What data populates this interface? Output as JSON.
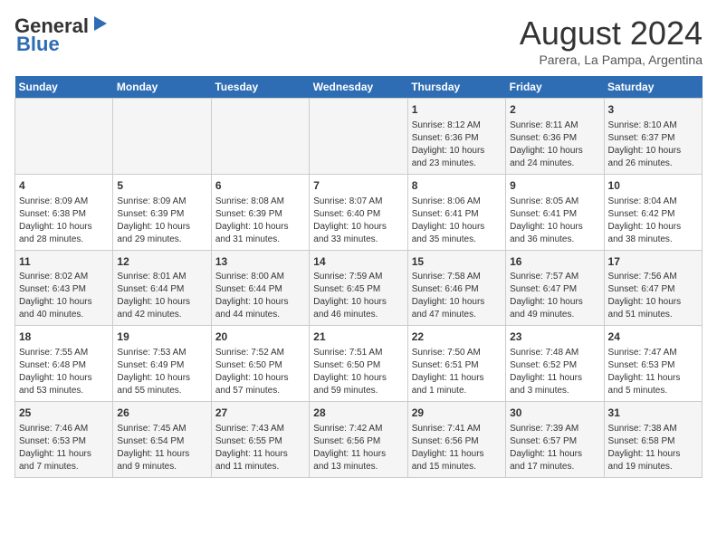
{
  "header": {
    "logo_general": "General",
    "logo_blue": "Blue",
    "month_title": "August 2024",
    "subtitle": "Parera, La Pampa, Argentina"
  },
  "days_of_week": [
    "Sunday",
    "Monday",
    "Tuesday",
    "Wednesday",
    "Thursday",
    "Friday",
    "Saturday"
  ],
  "weeks": [
    [
      {
        "day": "",
        "info": ""
      },
      {
        "day": "",
        "info": ""
      },
      {
        "day": "",
        "info": ""
      },
      {
        "day": "",
        "info": ""
      },
      {
        "day": "1",
        "info": "Sunrise: 8:12 AM\nSunset: 6:36 PM\nDaylight: 10 hours\nand 23 minutes."
      },
      {
        "day": "2",
        "info": "Sunrise: 8:11 AM\nSunset: 6:36 PM\nDaylight: 10 hours\nand 24 minutes."
      },
      {
        "day": "3",
        "info": "Sunrise: 8:10 AM\nSunset: 6:37 PM\nDaylight: 10 hours\nand 26 minutes."
      }
    ],
    [
      {
        "day": "4",
        "info": "Sunrise: 8:09 AM\nSunset: 6:38 PM\nDaylight: 10 hours\nand 28 minutes."
      },
      {
        "day": "5",
        "info": "Sunrise: 8:09 AM\nSunset: 6:39 PM\nDaylight: 10 hours\nand 29 minutes."
      },
      {
        "day": "6",
        "info": "Sunrise: 8:08 AM\nSunset: 6:39 PM\nDaylight: 10 hours\nand 31 minutes."
      },
      {
        "day": "7",
        "info": "Sunrise: 8:07 AM\nSunset: 6:40 PM\nDaylight: 10 hours\nand 33 minutes."
      },
      {
        "day": "8",
        "info": "Sunrise: 8:06 AM\nSunset: 6:41 PM\nDaylight: 10 hours\nand 35 minutes."
      },
      {
        "day": "9",
        "info": "Sunrise: 8:05 AM\nSunset: 6:41 PM\nDaylight: 10 hours\nand 36 minutes."
      },
      {
        "day": "10",
        "info": "Sunrise: 8:04 AM\nSunset: 6:42 PM\nDaylight: 10 hours\nand 38 minutes."
      }
    ],
    [
      {
        "day": "11",
        "info": "Sunrise: 8:02 AM\nSunset: 6:43 PM\nDaylight: 10 hours\nand 40 minutes."
      },
      {
        "day": "12",
        "info": "Sunrise: 8:01 AM\nSunset: 6:44 PM\nDaylight: 10 hours\nand 42 minutes."
      },
      {
        "day": "13",
        "info": "Sunrise: 8:00 AM\nSunset: 6:44 PM\nDaylight: 10 hours\nand 44 minutes."
      },
      {
        "day": "14",
        "info": "Sunrise: 7:59 AM\nSunset: 6:45 PM\nDaylight: 10 hours\nand 46 minutes."
      },
      {
        "day": "15",
        "info": "Sunrise: 7:58 AM\nSunset: 6:46 PM\nDaylight: 10 hours\nand 47 minutes."
      },
      {
        "day": "16",
        "info": "Sunrise: 7:57 AM\nSunset: 6:47 PM\nDaylight: 10 hours\nand 49 minutes."
      },
      {
        "day": "17",
        "info": "Sunrise: 7:56 AM\nSunset: 6:47 PM\nDaylight: 10 hours\nand 51 minutes."
      }
    ],
    [
      {
        "day": "18",
        "info": "Sunrise: 7:55 AM\nSunset: 6:48 PM\nDaylight: 10 hours\nand 53 minutes."
      },
      {
        "day": "19",
        "info": "Sunrise: 7:53 AM\nSunset: 6:49 PM\nDaylight: 10 hours\nand 55 minutes."
      },
      {
        "day": "20",
        "info": "Sunrise: 7:52 AM\nSunset: 6:50 PM\nDaylight: 10 hours\nand 57 minutes."
      },
      {
        "day": "21",
        "info": "Sunrise: 7:51 AM\nSunset: 6:50 PM\nDaylight: 10 hours\nand 59 minutes."
      },
      {
        "day": "22",
        "info": "Sunrise: 7:50 AM\nSunset: 6:51 PM\nDaylight: 11 hours\nand 1 minute."
      },
      {
        "day": "23",
        "info": "Sunrise: 7:48 AM\nSunset: 6:52 PM\nDaylight: 11 hours\nand 3 minutes."
      },
      {
        "day": "24",
        "info": "Sunrise: 7:47 AM\nSunset: 6:53 PM\nDaylight: 11 hours\nand 5 minutes."
      }
    ],
    [
      {
        "day": "25",
        "info": "Sunrise: 7:46 AM\nSunset: 6:53 PM\nDaylight: 11 hours\nand 7 minutes."
      },
      {
        "day": "26",
        "info": "Sunrise: 7:45 AM\nSunset: 6:54 PM\nDaylight: 11 hours\nand 9 minutes."
      },
      {
        "day": "27",
        "info": "Sunrise: 7:43 AM\nSunset: 6:55 PM\nDaylight: 11 hours\nand 11 minutes."
      },
      {
        "day": "28",
        "info": "Sunrise: 7:42 AM\nSunset: 6:56 PM\nDaylight: 11 hours\nand 13 minutes."
      },
      {
        "day": "29",
        "info": "Sunrise: 7:41 AM\nSunset: 6:56 PM\nDaylight: 11 hours\nand 15 minutes."
      },
      {
        "day": "30",
        "info": "Sunrise: 7:39 AM\nSunset: 6:57 PM\nDaylight: 11 hours\nand 17 minutes."
      },
      {
        "day": "31",
        "info": "Sunrise: 7:38 AM\nSunset: 6:58 PM\nDaylight: 11 hours\nand 19 minutes."
      }
    ]
  ]
}
